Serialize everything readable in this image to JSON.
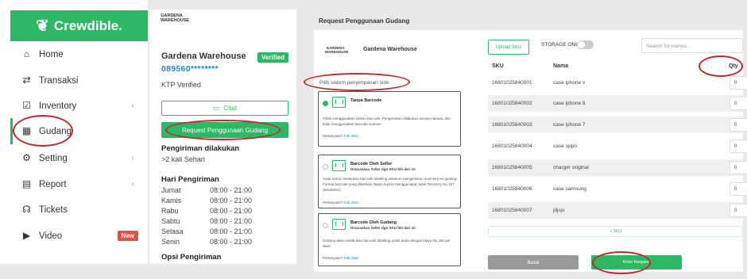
{
  "sidebar": {
    "brand": "Crewdible.",
    "items": [
      {
        "label": "Home",
        "icon": "home-icon"
      },
      {
        "label": "Transaksi",
        "icon": "transfer-icon"
      },
      {
        "label": "Inventory",
        "icon": "clipboard-icon"
      },
      {
        "label": "Gudang",
        "icon": "warehouse-icon"
      },
      {
        "label": "Setting",
        "icon": "gear-icon"
      },
      {
        "label": "Report",
        "icon": "document-icon"
      },
      {
        "label": "Tickets",
        "icon": "headset-icon"
      },
      {
        "label": "Video",
        "icon": "video-icon"
      }
    ],
    "video_badge": "New"
  },
  "detail": {
    "logo_line1": "GARDENA",
    "logo_line2": "WAREHOUSE",
    "name": "Gardena Warehouse",
    "verified": "Verified",
    "phone": "089560********",
    "ktp": "KTP Verified",
    "chat": "Chat",
    "request_button": "Request Penggunaan Gudang",
    "pengiriman_title": "Pengiriman dilakukan",
    "pengiriman_value": ">2 kali Sehari",
    "hari_title": "Hari Pengiriman",
    "schedule": [
      {
        "day": "Jumat",
        "time": "08:00 - 21:00"
      },
      {
        "day": "Kamis",
        "time": "08:00 - 21:00"
      },
      {
        "day": "Rabu",
        "time": "08:00 - 21:00"
      },
      {
        "day": "Sabtu",
        "time": "08:00 - 21:00"
      },
      {
        "day": "Selasa",
        "time": "08:00 - 21:00"
      },
      {
        "day": "Senin",
        "time": "08:00 - 21:00"
      }
    ],
    "opsi_title": "Opsi Pengiriman"
  },
  "request": {
    "title": "Request Penggunaan Gudang",
    "logo_line1": "GARDENA",
    "logo_line2": "WAREHOUSE",
    "warehouse_name": "Gardena Warehouse",
    "pilih_label": "Pilih sistem penyimpanan stok",
    "options": [
      {
        "title": "Tanpa Barcode",
        "subtitle": "",
        "desc": "Tidak menggunakan sistem barcode. Pengecekan dilakukan secara manual, dan tidak menggunakan barcode scanner.",
        "question": "Pertanyaan?",
        "link": "Klik disini"
      },
      {
        "title": "Barcode Oleh Seller",
        "subtitle": "Disarankan Seller dgn SKU lbh dari 10",
        "desc": "Anda harus melakukan barcode labelling sebelum mengirimkan inventory ke gudang. Format barcode yang diberikan dapat di-print menggunakan label TomJerry No.107 (50x20mm)",
        "question": "Pertanyaan?",
        "link": "Klik disini"
      },
      {
        "title": "Barcode Oleh Gudang",
        "subtitle": "Disarankan Seller dgn SKU lbh dari 10",
        "desc": "Gudang akan melakukan barcode labelling untuk anda dengan biaya Rp.250 per label.",
        "question": "Pertanyaan?",
        "link": "Klik disini"
      }
    ],
    "upload_sku": "Upload SKU",
    "storage_only": "STORAGE ONLY",
    "search_placeholder": "Search for names..",
    "headers": {
      "sku": "SKU",
      "nama": "Nama",
      "qty": "Qty"
    },
    "rows": [
      {
        "sku": "16801025840001",
        "name": "case iphone x",
        "qty": "0"
      },
      {
        "sku": "16801025840002",
        "name": "case iphone 8",
        "qty": "0"
      },
      {
        "sku": "16801025840003",
        "name": "case iphone 7",
        "qty": "0"
      },
      {
        "sku": "16801025840004",
        "name": "case oppo",
        "qty": "0"
      },
      {
        "sku": "16801025840005",
        "name": "charger original",
        "qty": "0"
      },
      {
        "sku": "16801025840006",
        "name": "case samsung",
        "qty": "0"
      },
      {
        "sku": "16801025840007",
        "name": "jdjsjs",
        "qty": "0"
      }
    ],
    "add_sku": "+ SKU",
    "batal": "Batal",
    "kirim": "Kirim Request"
  },
  "colors": {
    "brand_green": "#2eb865",
    "highlight_red": "#c0282f",
    "link_blue": "#1e88c9"
  }
}
